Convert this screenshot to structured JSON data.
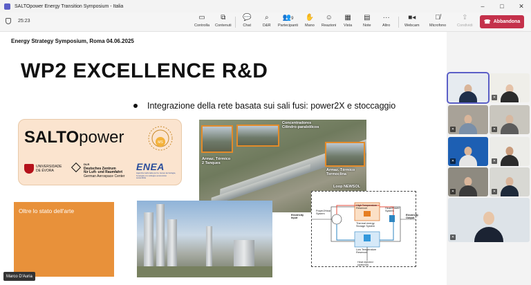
{
  "window": {
    "title": "SALTOpower Energy Transition Symposium - Italia",
    "controls": [
      "minimize-icon",
      "maximize-icon",
      "close-icon"
    ]
  },
  "toolbar": {
    "timer": "25:23",
    "buttons": [
      {
        "id": "controlla",
        "label": "Controlla",
        "icon": "tv"
      },
      {
        "id": "contenuti",
        "label": "Contenuti",
        "icon": "share"
      },
      {
        "id": "chat",
        "label": "Chat",
        "icon": "chat"
      },
      {
        "id": "dr",
        "label": "D&R",
        "icon": "qa"
      },
      {
        "id": "partecipanti",
        "label": "Partecipanti",
        "icon": "people",
        "count": "9"
      },
      {
        "id": "mano",
        "label": "Mano",
        "icon": "hand"
      },
      {
        "id": "reazioni",
        "label": "Reazioni",
        "icon": "smile"
      },
      {
        "id": "vista",
        "label": "Vista",
        "icon": "grid"
      },
      {
        "id": "note",
        "label": "Note",
        "icon": "note"
      },
      {
        "id": "altro",
        "label": "Altro",
        "icon": "more"
      },
      {
        "id": "webcam",
        "label": "Webcam",
        "icon": "camera"
      },
      {
        "id": "microfono",
        "label": "Microfono",
        "icon": "mic-off"
      },
      {
        "id": "condividi",
        "label": "Condividi",
        "icon": "share-up"
      }
    ],
    "leave_label": "Abbandona"
  },
  "slide": {
    "header": "Energy Strategy Symposium, Roma  04.06.2025",
    "title": "WP2 EXCELLENCE R&D",
    "bullet": "Integrazione della rete basata sui sali fusi: power2X e stoccaggio",
    "logo": {
      "main_bold": "SALTO",
      "main_light": "power",
      "badge": "MS",
      "uni": [
        "UNIVERSIDADE",
        "DE ÉVORA"
      ],
      "dlr": [
        "Deutsches Zentrum",
        "für Luft- und Raumfahrt",
        "German Aerospace Center"
      ],
      "dlr_short": "DLR",
      "enea": "ENEA",
      "enea_sub": "Agenzia nazionale per le nuove tecnologie, l'energia e lo sviluppo economico sostenibile"
    },
    "orange_box": "Oltre lo stato dell'arte",
    "aerial_labels": {
      "concentratori": [
        "Concentradores",
        "Cilindro-parabólicos"
      ],
      "armaz_tanques": [
        "Armaz. Térmico",
        "2 Tanques"
      ],
      "armaz_termoclina": [
        "Armaz. Térmico",
        "Termoclina"
      ],
      "loop": "Loop NEWSOL"
    },
    "diagram_labels": {
      "electricity_input": [
        "Electricity",
        "Input"
      ],
      "electricity_output": [
        "Electricity",
        "Output"
      ],
      "high_temp": [
        "High Temperature",
        "Reservoir"
      ],
      "thermal_storage": [
        "Thermal energy",
        "Storage System"
      ],
      "low_temp": [
        "Low Temperature",
        "Reservoir"
      ],
      "heat_power": [
        "Heat2Power",
        "System"
      ],
      "power_heat": [
        "Power2Heat",
        "System"
      ],
      "heat_rejected": [
        "Heat rejected",
        "(optional)"
      ]
    }
  },
  "presenter": {
    "name": "Marco D'Auria"
  },
  "colors": {
    "leave": "#c4314b",
    "accent": "#5b5fc7",
    "orange_box": "#e8913a"
  }
}
